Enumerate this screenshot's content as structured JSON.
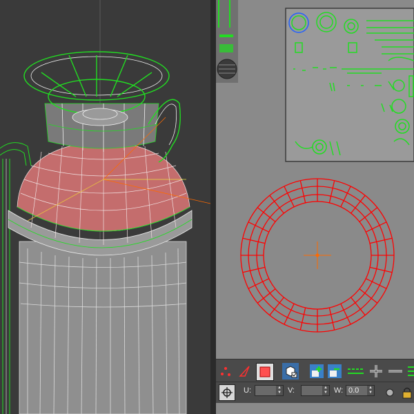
{
  "viewport": {
    "label": "perspective-viewport"
  },
  "uv_editor": {
    "toolbar": {
      "icons": [
        "vertex-select-icon",
        "edge-select-icon",
        "face-select-icon",
        "element-select-icon",
        "add-icon",
        "remove-icon",
        "ring-icon",
        "cross-icon",
        "loop-icon",
        "bars-icon"
      ]
    },
    "coords": {
      "u_label": "U:",
      "v_label": "V:",
      "w_label": "W:",
      "u_value": "",
      "v_value": "",
      "w_value": "0.0"
    }
  },
  "colors": {
    "viewport_bg": "#3a3a3a",
    "uv_bg": "#8a8a8a",
    "wire_green": "#22dd22",
    "wire_white": "#f2f2f2",
    "selection_red": "#ff0000",
    "gizmo_orange": "#ff6a00",
    "toolbar_bg": "#4a4a4a"
  }
}
